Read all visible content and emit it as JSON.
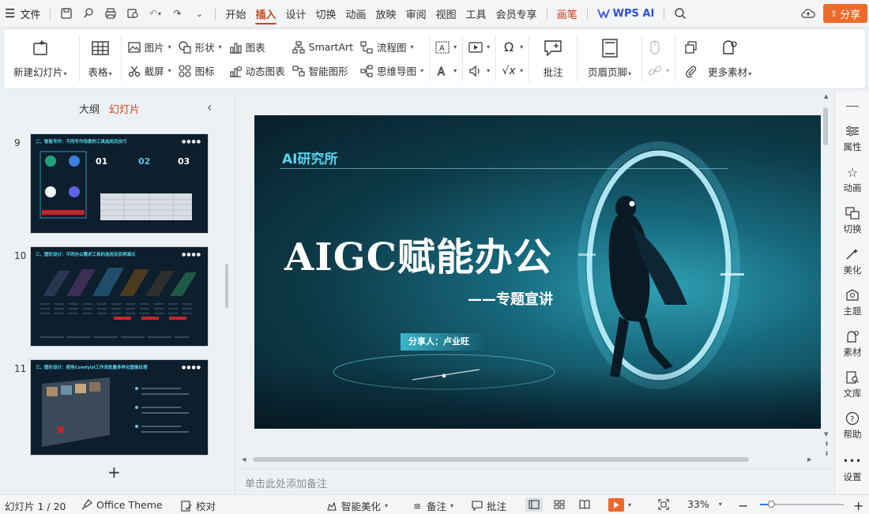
{
  "menubar": {
    "file_label": "文件",
    "tabs": [
      {
        "label": "开始"
      },
      {
        "label": "插入"
      },
      {
        "label": "设计"
      },
      {
        "label": "切换"
      },
      {
        "label": "动画"
      },
      {
        "label": "放映"
      },
      {
        "label": "审阅"
      },
      {
        "label": "视图"
      },
      {
        "label": "工具"
      },
      {
        "label": "会员专享"
      },
      {
        "label": "画笔"
      },
      {
        "label": "WPS AI"
      }
    ],
    "active_tab": "插入",
    "share_label": "分享"
  },
  "ribbon": {
    "new_slide": "新建幻灯片",
    "table": "表格",
    "picture": "图片",
    "screenshot": "截屏",
    "shape": "形状",
    "icon": "图标",
    "chart": "图表",
    "dynamic_chart": "动态图表",
    "smartart": "SmartArt",
    "smart_shape": "智能图形",
    "flowchart": "流程图",
    "mindmap": "思维导图",
    "comment": "批注",
    "header_footer": "页眉页脚",
    "more_materials": "更多素材"
  },
  "left_panel": {
    "tab_outline": "大纲",
    "tab_slides": "幻灯片",
    "slides": [
      {
        "number": "9",
        "title": "二、智能写作：不同写作场景的工具选用及技巧"
      },
      {
        "number": "10",
        "title": "三、图形设计：不同办公需求工具的选用及实例演示"
      },
      {
        "number": "11",
        "title": "三、图形设计：使用ComfyUI工作流批量多样化图像处理"
      }
    ]
  },
  "slide": {
    "brand": "AI研究所",
    "title": "AIGC赋能办公",
    "subtitle": "——专题宣讲",
    "presenter": "分享人：卢业旺"
  },
  "notes_placeholder": "单击此处添加备注",
  "right_sidebar": {
    "items": [
      {
        "label": "属性",
        "icon": "properties-icon"
      },
      {
        "label": "动画",
        "icon": "animation-icon"
      },
      {
        "label": "切换",
        "icon": "transition-icon"
      },
      {
        "label": "美化",
        "icon": "beautify-icon"
      },
      {
        "label": "主题",
        "icon": "theme-icon"
      },
      {
        "label": "素材",
        "icon": "material-icon"
      },
      {
        "label": "文库",
        "icon": "library-icon"
      },
      {
        "label": "帮助",
        "icon": "help-icon"
      },
      {
        "label": "设置",
        "icon": "settings-icon"
      }
    ]
  },
  "statusbar": {
    "slide_counter": "幻灯片 1 / 20",
    "theme": "Office Theme",
    "proofread": "校对",
    "smart_beautify": "智能美化",
    "notes": "备注",
    "comments": "批注",
    "zoom": "33%"
  },
  "colors": {
    "accent": "#c7491c",
    "share": "#ef6a2a",
    "slide_cyan": "#56d3ee"
  }
}
